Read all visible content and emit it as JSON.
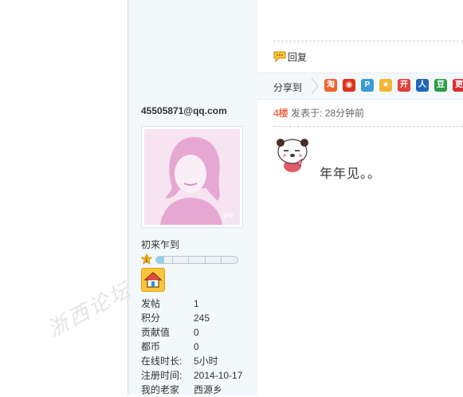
{
  "user": {
    "name": "45505871@qq.com",
    "avatar_watermark": "pw",
    "rank_title": "初来乍到",
    "level": {
      "value": 1,
      "progress": 0.1
    },
    "stats": [
      {
        "label": "发帖",
        "value": "1"
      },
      {
        "label": "积分",
        "value": "245"
      },
      {
        "label": "贡献值",
        "value": "0"
      },
      {
        "label": "都币",
        "value": "0"
      },
      {
        "label": "在线时长:",
        "value": "5小时"
      },
      {
        "label": "注册时间:",
        "value": "2014-10-17"
      },
      {
        "label": "我的老家",
        "value": "西源乡"
      }
    ]
  },
  "actions": {
    "reply": "回复"
  },
  "share": {
    "label": "分享到",
    "icons": [
      {
        "name": "taobao-icon",
        "glyph": "淘",
        "color": "#f0622f"
      },
      {
        "name": "weibo-icon",
        "glyph": "◉",
        "color": "#e0321c"
      },
      {
        "name": "qq-space-icon",
        "glyph": "P",
        "color": "#3a9bd8"
      },
      {
        "name": "qq-favorite-icon",
        "glyph": "★",
        "color": "#f2b632"
      },
      {
        "name": "kaixin-icon",
        "glyph": "开",
        "color": "#e2403a"
      },
      {
        "name": "renren-icon",
        "glyph": "人",
        "color": "#2266bb"
      },
      {
        "name": "douban-icon",
        "glyph": "豆",
        "color": "#2c9e46"
      },
      {
        "name": "more-share-icon",
        "glyph": "更",
        "color": "#d83030"
      }
    ]
  },
  "post": {
    "floor": "4楼",
    "posted_label": "发表于: 28分钟前",
    "message": "年年见。。"
  },
  "watermark": "浙西论坛"
}
